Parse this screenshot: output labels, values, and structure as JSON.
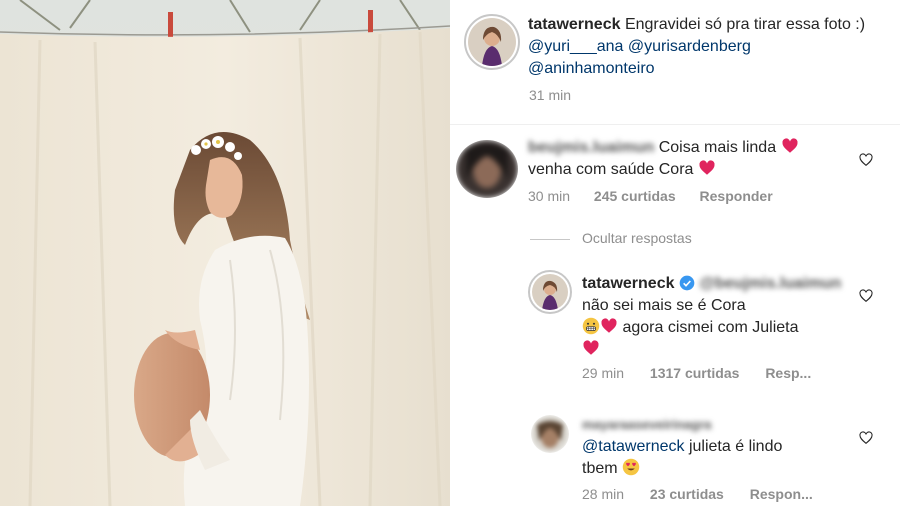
{
  "post": {
    "author": "tatawerneck",
    "caption_text": "Engravidei só pra tirar essa foto :) ",
    "caption_mentions": [
      "@yuri___ana",
      "@yurisardenberg",
      "@aninhamonteiro"
    ],
    "time": "31 min"
  },
  "comment1": {
    "username_blurred": "beujmis.luaimun",
    "text_line1": "Coisa mais linda",
    "text_line2": "venha com saúde Cora",
    "time": "30 min",
    "likes": "245 curtidas",
    "reply": "Responder"
  },
  "hide_replies": "Ocultar respostas",
  "reply1": {
    "username": "tatawerneck",
    "mention_blurred": "@beujmis.luaimun",
    "text_a": "não sei mais se é Cora",
    "text_b": "agora cismei com Julieta",
    "time": "29 min",
    "likes": "1317 curtidas",
    "reply": "Resp..."
  },
  "reply2": {
    "username_blurred": "mayaraaseveirinagra",
    "mention": "@tatawerneck",
    "text_a": "julieta é lindo",
    "text_b": "tbem",
    "time": "28 min",
    "likes": "23 curtidas",
    "reply": "Respon..."
  },
  "colors": {
    "text": "#262626",
    "mention": "#00376b",
    "meta": "#8e8e8e",
    "heart": "#e0245e",
    "verified": "#3897f0"
  },
  "icons": [
    "heart-outline-icon",
    "red-heart-emoji",
    "verified-badge-icon",
    "grimace-emoji",
    "heart-eyes-emoji"
  ]
}
